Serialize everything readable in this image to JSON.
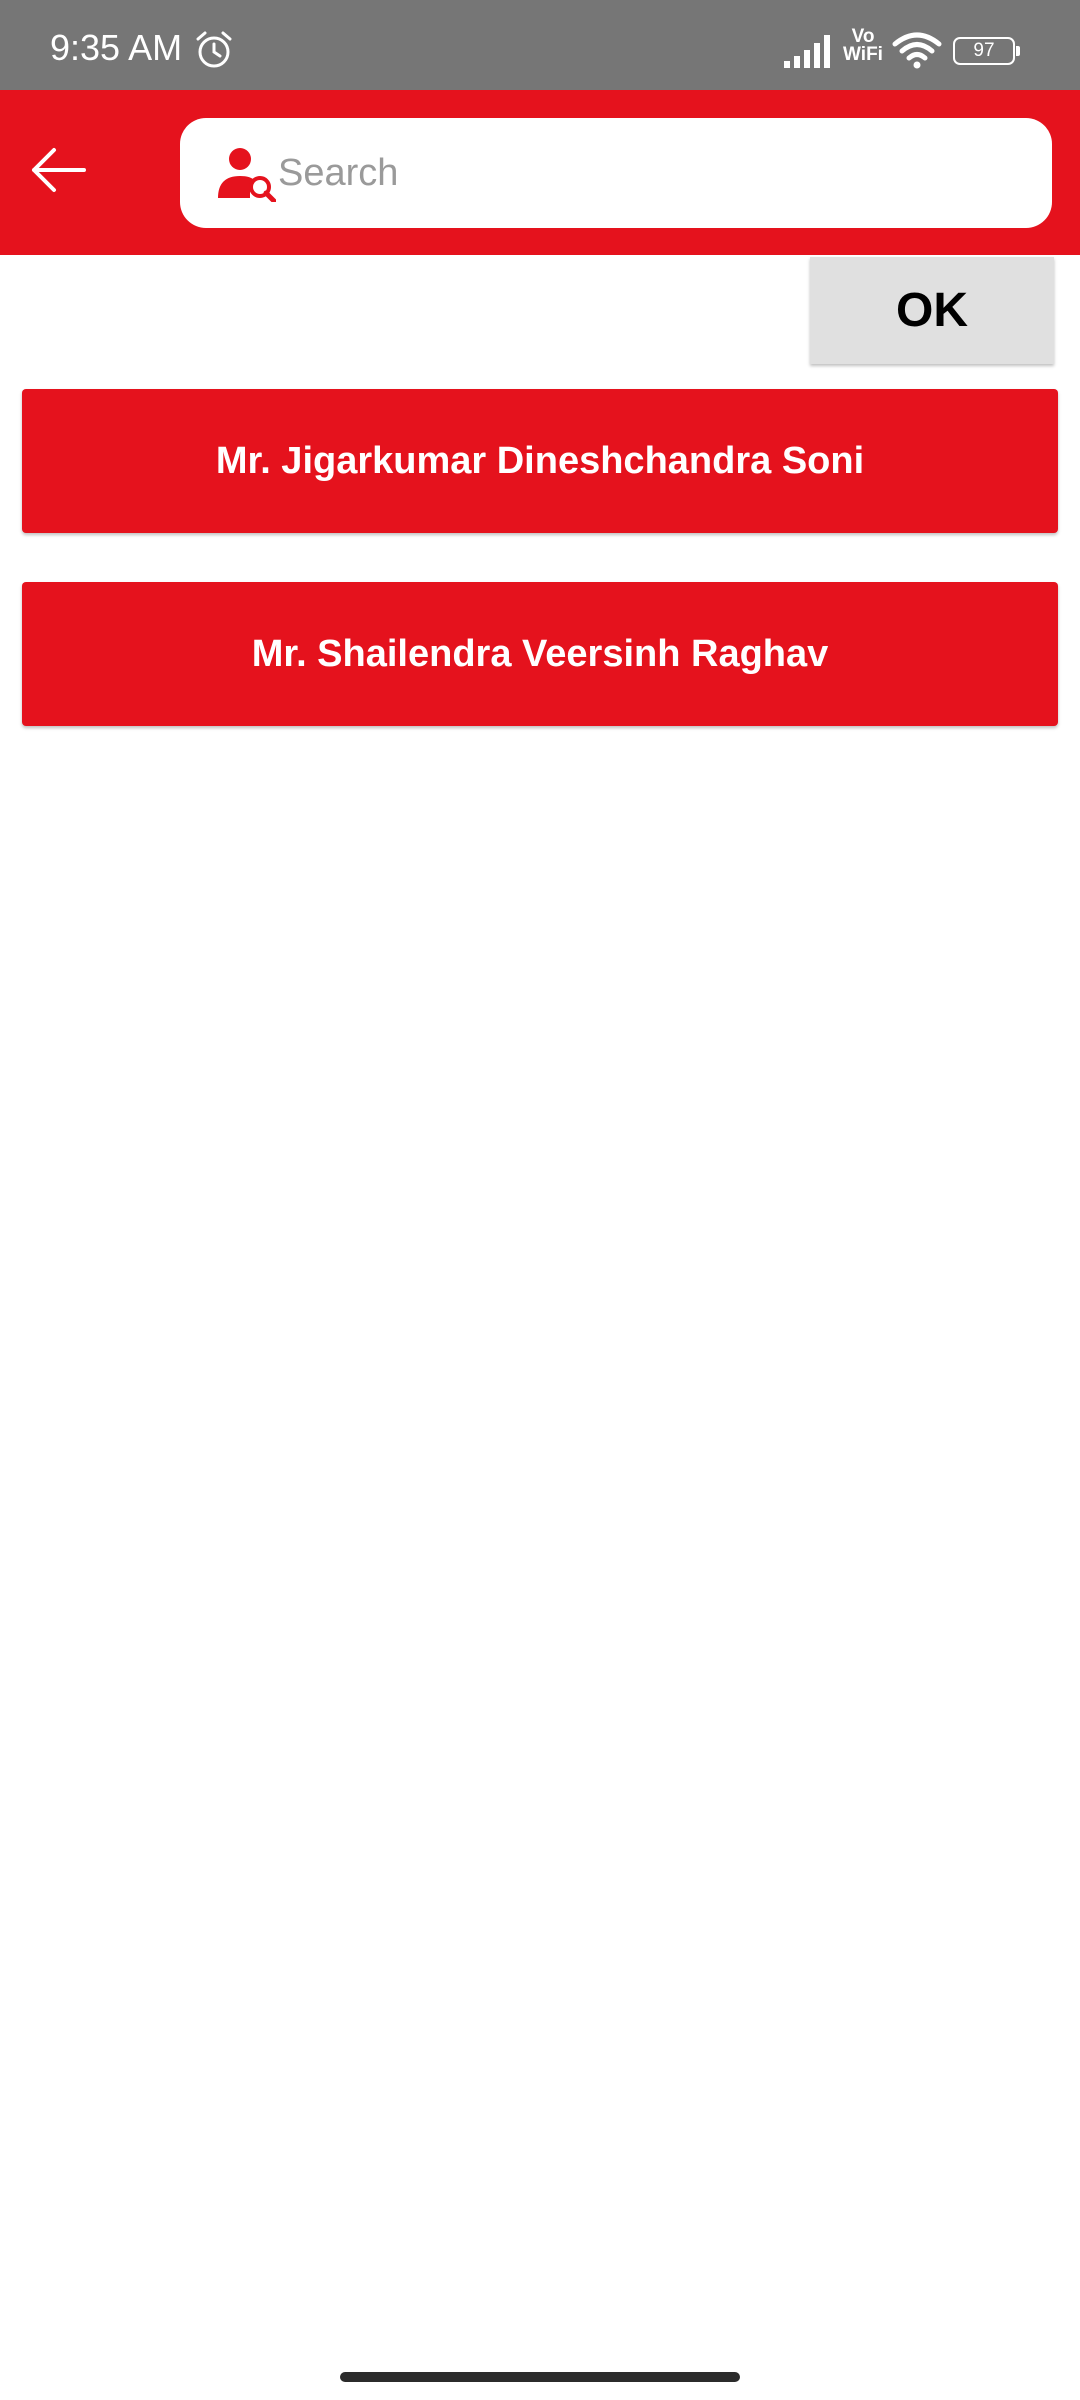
{
  "status_bar": {
    "time": "9:35 AM",
    "network_label": "Vo WiFi",
    "battery_level": "97"
  },
  "icons": {
    "back": "arrow-left-icon",
    "search": "user-search-icon",
    "alarm": "alarm-icon",
    "signal": "signal-icon",
    "wifi": "wifi-icon"
  },
  "search": {
    "placeholder": "Search",
    "value": ""
  },
  "actions": {
    "ok_label": "OK"
  },
  "results": [
    {
      "name": "Mr. Jigarkumar Dineshchandra Soni"
    },
    {
      "name": "Mr. Shailendra Veersinh Raghav"
    }
  ],
  "colors": {
    "accent": "#e5121d",
    "status_bar": "#767676",
    "ok_button": "#e0e0e0"
  }
}
